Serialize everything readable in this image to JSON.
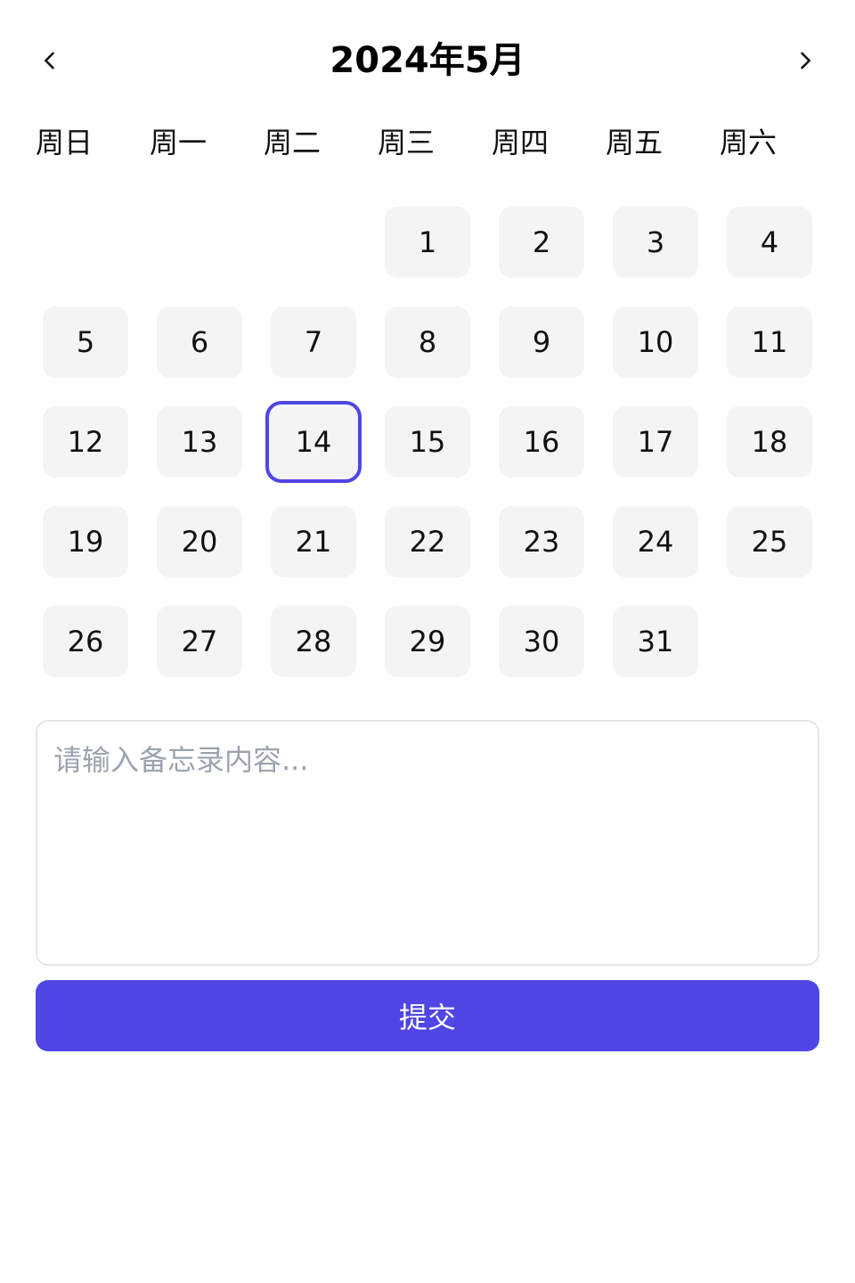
{
  "header": {
    "title": "2024年5月",
    "prev_icon": "chevron-left-icon",
    "next_icon": "chevron-right-icon"
  },
  "weekdays": [
    "周日",
    "周一",
    "周二",
    "周三",
    "周四",
    "周五",
    "周六"
  ],
  "calendar": {
    "first_weekday_index": 3,
    "days": [
      "1",
      "2",
      "3",
      "4",
      "5",
      "6",
      "7",
      "8",
      "9",
      "10",
      "11",
      "12",
      "13",
      "14",
      "15",
      "16",
      "17",
      "18",
      "19",
      "20",
      "21",
      "22",
      "23",
      "24",
      "25",
      "26",
      "27",
      "28",
      "29",
      "30",
      "31"
    ],
    "selected_day": "14"
  },
  "memo": {
    "value": "",
    "placeholder": "请输入备忘录内容..."
  },
  "submit": {
    "label": "提交"
  },
  "colors": {
    "accent": "#4f46e5",
    "day_bg": "#f3f4f6",
    "border": "#e5e7eb",
    "placeholder": "#9ca3af"
  }
}
